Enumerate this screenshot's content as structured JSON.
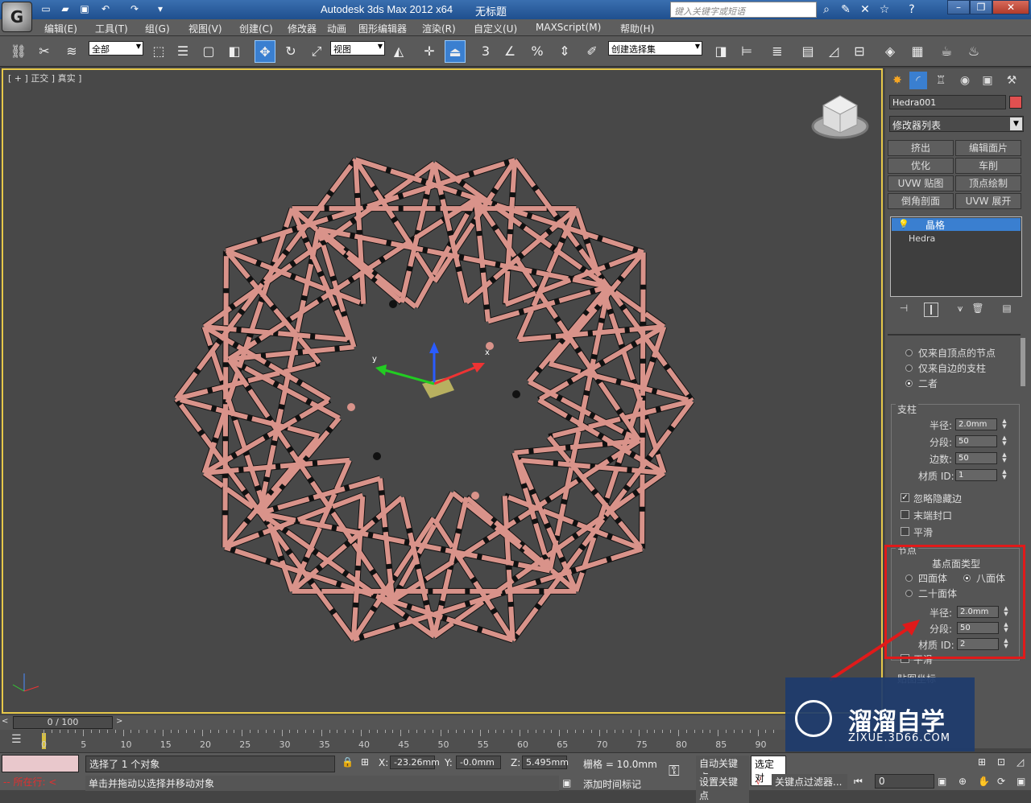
{
  "titlebar": {
    "app_title": "Autodesk 3ds Max  2012 x64",
    "doc_title": "无标题",
    "search_placeholder": "键入关键字或短语"
  },
  "menu": [
    "编辑(E)",
    "工具(T)",
    "组(G)",
    "视图(V)",
    "创建(C)",
    "修改器",
    "动画",
    "图形编辑器",
    "渲染(R)",
    "自定义(U)",
    "MAXScript(M)",
    "帮助(H)"
  ],
  "toolbar": {
    "selection_filter": "全部",
    "ref_coord": "视图",
    "named_selection": "创建选择集",
    "snap_3": "3",
    "percent": "%"
  },
  "viewport": {
    "label": "[ + ] 正交 ] 真实 ]",
    "label_parts": [
      "[ +",
      "正交",
      "真实",
      "]"
    ],
    "gizmo_x": "x",
    "gizmo_y": "y"
  },
  "command_panel": {
    "object_name": "Hedra001",
    "object_color": "#e05050",
    "modifier_list": "修改器列表",
    "modifier_buttons": [
      "挤出",
      "编辑面片",
      "优化",
      "车削",
      "UVW 贴图",
      "顶点绘制",
      "倒角剖面",
      "UVW 展开"
    ],
    "stack": {
      "selected": "晶格",
      "base": "Hedra"
    },
    "geometry": {
      "options": [
        "仅来自顶点的节点",
        "仅来自边的支柱",
        "二者"
      ],
      "selected_index": 2
    },
    "struts": {
      "title": "支柱",
      "radius_label": "半径:",
      "radius": "2.0mm",
      "segments_label": "分段:",
      "segments": "50",
      "sides_label": "边数:",
      "sides": "50",
      "matid_label": "材质 ID:",
      "matid": "1",
      "ignore_hidden": "忽略隐藏边",
      "end_caps": "末端封口",
      "smooth": "平滑"
    },
    "joints": {
      "title": "节点",
      "base_type_label": "基点面类型",
      "tetra": "四面体",
      "octa": "八面体",
      "icosa": "二十面体",
      "radius_label": "半径:",
      "radius": "2.0mm",
      "segments_label": "分段:",
      "segments": "50",
      "matid_label": "材质 ID:",
      "matid": "2",
      "smooth": "平滑"
    },
    "mapping_title": "贴图坐标"
  },
  "timeslider": {
    "position": "0 / 100"
  },
  "trackbar_ticks": [
    "0",
    "5",
    "10",
    "15",
    "20",
    "25",
    "30",
    "35",
    "40",
    "45",
    "50",
    "55",
    "60",
    "65",
    "70",
    "75",
    "80",
    "85",
    "90"
  ],
  "statusbar": {
    "selection_status": "选择了 1 个对象",
    "prompt": "单击并拖动以选择并移动对象",
    "listener_label": "所在行:",
    "x_label": "X:",
    "x": "-23.26mm",
    "y_label": "Y:",
    "y": "-0.0mm",
    "z_label": "Z:",
    "z": "5.495mm",
    "grid": "栅格 = 10.0mm",
    "auto_key": "自动关键点",
    "set_key": "设置关键点",
    "selected_dd": "选定对",
    "key_filters": "关键点过滤器...",
    "add_time_tag": "添加时间标记",
    "frame": "0"
  },
  "watermark": {
    "title": "溜溜自学",
    "url": "ZIXUE.3D66.COM"
  }
}
